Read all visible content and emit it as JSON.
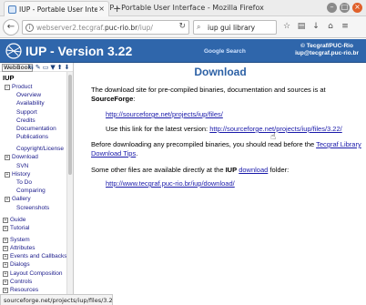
{
  "window": {
    "title": "IUP - Portable User Interface - Mozilla Firefox",
    "minimize": "–",
    "maximize": "□",
    "close": "×"
  },
  "tab": {
    "label": "IUP - Portable User Interface",
    "close": "×",
    "new": "+"
  },
  "toolbar": {
    "url_host_muted": "webserver2.tecgraf.",
    "url_host": "puc-rio.br",
    "url_path": "/iup/",
    "search_value": "iup gui library",
    "icons": [
      "star-icon",
      "clipboard-icon",
      "download-icon",
      "home-icon",
      "menu-icon"
    ]
  },
  "banner": {
    "title": "IUP - Version 3.22",
    "google_search": "Google Search",
    "tecgraf_line1": "© Tecgraf/PUC-Rio",
    "tecgraf_line2": "iup@tecgraf.puc-rio.br"
  },
  "sidebar": {
    "webbook_label": "WebBook",
    "tools": [
      "⇆",
      "✎",
      "▭",
      "▼",
      "⬆",
      "⬇"
    ],
    "root": "IUP",
    "items": [
      {
        "label": "Product",
        "type": "folder-open"
      },
      {
        "label": "Overview",
        "type": "leaf"
      },
      {
        "label": "Availability",
        "type": "leaf"
      },
      {
        "label": "Support",
        "type": "leaf"
      },
      {
        "label": "Credits",
        "type": "leaf"
      },
      {
        "label": "Documentation",
        "type": "leaf"
      },
      {
        "label": "Publications",
        "type": "leaf"
      },
      {
        "label": "Copyright/License",
        "type": "leaf"
      },
      {
        "label": "Download",
        "type": "folder"
      },
      {
        "label": "SVN",
        "type": "leaf"
      },
      {
        "label": "History",
        "type": "folder"
      },
      {
        "label": "To Do",
        "type": "leaf"
      },
      {
        "label": "Comparing",
        "type": "leaf"
      },
      {
        "label": "Gallery",
        "type": "folder"
      },
      {
        "label": "Screenshots",
        "type": "leaf"
      },
      {
        "label": "Guide",
        "type": "top"
      },
      {
        "label": "Tutorial",
        "type": "top"
      },
      {
        "label": "System",
        "type": "top"
      },
      {
        "label": "Attributes",
        "type": "top"
      },
      {
        "label": "Events and Callbacks",
        "type": "top"
      },
      {
        "label": "Dialogs",
        "type": "top"
      },
      {
        "label": "Layout Composition",
        "type": "top"
      },
      {
        "label": "Controls",
        "type": "top"
      },
      {
        "label": "Resources",
        "type": "top"
      }
    ]
  },
  "content": {
    "heading": "Download",
    "intro_a": "The download site for pre-compiled binaries, documentation and sources is at",
    "intro_b": "SourceForge",
    "intro_c": ":",
    "link1": "http://sourceforge.net/projects/iup/files/",
    "latest_prefix": "Use this link for the latest version:",
    "link2": "http://sourceforge.net/projects/iup/files/3.22/",
    "before_a": "Before downloading any precompiled binaries, you should read before the",
    "before_link": "Tecgraf Library Download Tips",
    "before_end": ".",
    "other_a": "Some other files are available directly at the",
    "other_b": "IUP",
    "other_link": "download",
    "other_c": "folder:",
    "link3": "http://www.tecgraf.puc-rio.br/iup/download/"
  },
  "status": {
    "text": "sourceforge.net/projects/iup/files/3.22/"
  }
}
